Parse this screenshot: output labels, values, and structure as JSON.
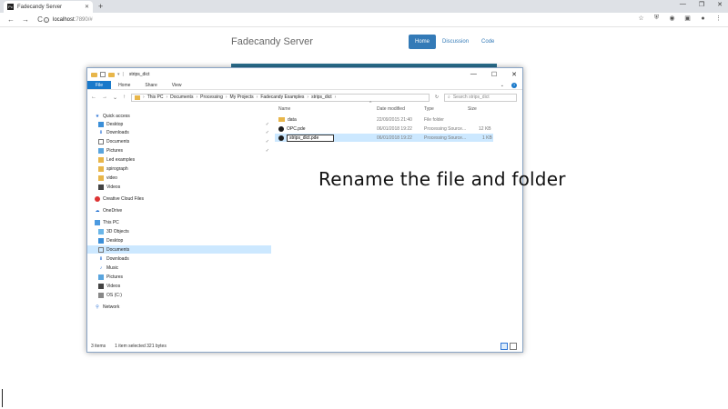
{
  "browser": {
    "tab_title": "Fadecandy Server",
    "tab_close": "✕",
    "new_tab": "+",
    "window_controls": [
      "—",
      "❐",
      "✕"
    ],
    "url_host": "localhost",
    "url_path": ":7890/#",
    "nav": {
      "back": "←",
      "forward": "→",
      "reload": "C"
    },
    "extension_icons": [
      "star-icon",
      "shield-icon",
      "camera-icon",
      "extension-icon",
      "account-icon",
      "menu-icon"
    ]
  },
  "site": {
    "title": "Fadecandy Server",
    "nav": [
      {
        "label": "Home",
        "active": true
      },
      {
        "label": "Discussion",
        "active": false
      },
      {
        "label": "Code",
        "active": false
      }
    ]
  },
  "explorer": {
    "title": "strips_dict",
    "window_controls": [
      "—",
      "☐",
      "✕"
    ],
    "ribbon_tabs": [
      "File",
      "Home",
      "Share",
      "View"
    ],
    "breadcrumb": [
      "This PC",
      "Documents",
      "Processing",
      "My Projects",
      "Fadecandy Examples",
      "strips_dict"
    ],
    "search_placeholder": "Search strips_dict",
    "nav_items": [
      {
        "label": "Quick access",
        "icon": "star-icon",
        "pinned": false
      },
      {
        "label": "Desktop",
        "icon": "desktop-icon",
        "pinned": true
      },
      {
        "label": "Downloads",
        "icon": "download-icon",
        "pinned": true
      },
      {
        "label": "Documents",
        "icon": "document-icon",
        "pinned": true
      },
      {
        "label": "Pictures",
        "icon": "picture-icon",
        "pinned": true
      },
      {
        "label": "Led examples",
        "icon": "folder-icon",
        "pinned": false
      },
      {
        "label": "spirograph",
        "icon": "folder-icon",
        "pinned": false
      },
      {
        "label": "video",
        "icon": "folder-icon",
        "pinned": false
      },
      {
        "label": "Videos",
        "icon": "video-icon",
        "pinned": false
      },
      {
        "label": "Creative Cloud Files",
        "icon": "creative-cloud-icon",
        "pinned": false
      },
      {
        "label": "OneDrive",
        "icon": "cloud-icon",
        "pinned": false
      },
      {
        "label": "This PC",
        "icon": "computer-icon",
        "pinned": false
      },
      {
        "label": "3D Objects",
        "icon": "cube-icon",
        "pinned": false
      },
      {
        "label": "Desktop",
        "icon": "desktop-icon",
        "pinned": false
      },
      {
        "label": "Documents",
        "icon": "document-icon",
        "pinned": false,
        "selected": true
      },
      {
        "label": "Downloads",
        "icon": "download-icon",
        "pinned": false
      },
      {
        "label": "Music",
        "icon": "music-icon",
        "pinned": false
      },
      {
        "label": "Pictures",
        "icon": "picture-icon",
        "pinned": false
      },
      {
        "label": "Videos",
        "icon": "video-icon",
        "pinned": false
      },
      {
        "label": "OS (C:)",
        "icon": "drive-icon",
        "pinned": false
      },
      {
        "label": "Network",
        "icon": "network-icon",
        "pinned": false
      }
    ],
    "columns": [
      "Name",
      "Date modified",
      "Type",
      "Size"
    ],
    "files": [
      {
        "name": "data",
        "date": "22/09/2015 21:40",
        "type": "File folder",
        "size": "",
        "icon": "folder-icon"
      },
      {
        "name": "OPC.pde",
        "date": "06/01/2018 19:22",
        "type": "Processing Source...",
        "size": "12 KB",
        "icon": "processing-file-icon"
      },
      {
        "name": "strips_dict.pde",
        "date": "06/01/2018 19:22",
        "type": "Processing Source...",
        "size": "1 KB",
        "icon": "processing-file-icon",
        "selected": true,
        "renaming": true
      }
    ],
    "status": {
      "items": "3 items",
      "selection": "1 item selected  321 bytes"
    }
  },
  "annotation": "Rename the file and folder"
}
